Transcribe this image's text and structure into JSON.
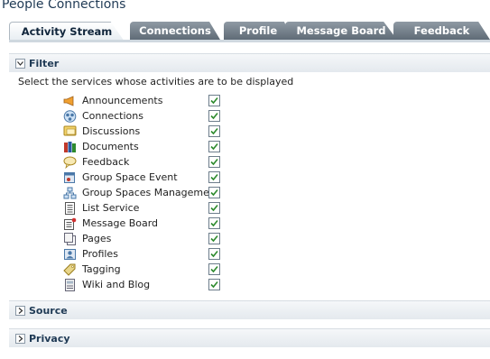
{
  "page": {
    "title": "People Connections"
  },
  "tabs": [
    {
      "label": "Activity Stream",
      "active": true
    },
    {
      "label": "Connections",
      "active": false
    },
    {
      "label": "Profile",
      "active": false
    },
    {
      "label": "Message Board",
      "active": false
    },
    {
      "label": "Feedback",
      "active": false
    }
  ],
  "filter": {
    "title": "Filter",
    "expanded": true,
    "instructions": "Select the services whose activities are to be displayed",
    "services": [
      {
        "label": "Announcements",
        "icon": "announcements-icon",
        "checked": true
      },
      {
        "label": "Connections",
        "icon": "connections-icon",
        "checked": true
      },
      {
        "label": "Discussions",
        "icon": "discussions-icon",
        "checked": true
      },
      {
        "label": "Documents",
        "icon": "documents-icon",
        "checked": true
      },
      {
        "label": "Feedback",
        "icon": "feedback-icon",
        "checked": true
      },
      {
        "label": "Group Space Event",
        "icon": "group-space-event-icon",
        "checked": true
      },
      {
        "label": "Group Spaces Management",
        "icon": "group-spaces-management-icon",
        "checked": true
      },
      {
        "label": "List Service",
        "icon": "list-service-icon",
        "checked": true
      },
      {
        "label": "Message Board",
        "icon": "message-board-icon",
        "checked": true
      },
      {
        "label": "Pages",
        "icon": "pages-icon",
        "checked": true
      },
      {
        "label": "Profiles",
        "icon": "profiles-icon",
        "checked": true
      },
      {
        "label": "Tagging",
        "icon": "tagging-icon",
        "checked": true
      },
      {
        "label": "Wiki and Blog",
        "icon": "wiki-and-blog-icon",
        "checked": true
      }
    ]
  },
  "source": {
    "title": "Source",
    "expanded": false
  },
  "privacy": {
    "title": "Privacy",
    "expanded": false
  },
  "colors": {
    "accent": "#1f3a55",
    "tab_inactive": "#6b7782",
    "check": "#2e8b2e"
  }
}
